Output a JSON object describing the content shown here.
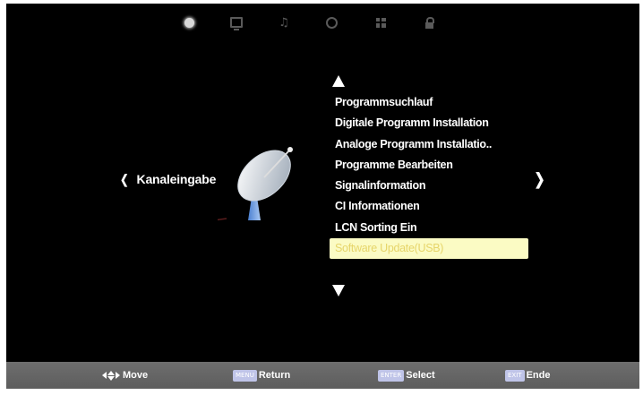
{
  "top_icons": [
    {
      "name": "channel-icon",
      "active": true
    },
    {
      "name": "picture-icon",
      "active": false
    },
    {
      "name": "sound-icon",
      "active": false
    },
    {
      "name": "time-icon",
      "active": false
    },
    {
      "name": "setup-icon",
      "active": false
    },
    {
      "name": "lock-icon",
      "active": false
    }
  ],
  "category": {
    "label": "Kanaleingabe"
  },
  "menu": {
    "items": [
      "Programmsuchlauf",
      "Digitale Programm Installation",
      "Analoge Programm Installatio..",
      "Programme Bearbeiten",
      "Signalinformation",
      "CI Informationen",
      "LCN Sorting Ein",
      "Software Update(USB)"
    ],
    "selected_index": 7
  },
  "bottom_bar": {
    "move": {
      "label": "Move"
    },
    "return": {
      "key": "MENU",
      "label": "Return"
    },
    "select": {
      "key": "ENTER",
      "label": "Select"
    },
    "exit": {
      "key": "EXIT",
      "label": "Ende"
    }
  },
  "colors": {
    "background": "#000000",
    "selected_bg": "#fbfbc4",
    "selected_text": "#e6d56a",
    "bottom_bar": "#666666",
    "key_badge": "#bfc4e8"
  }
}
